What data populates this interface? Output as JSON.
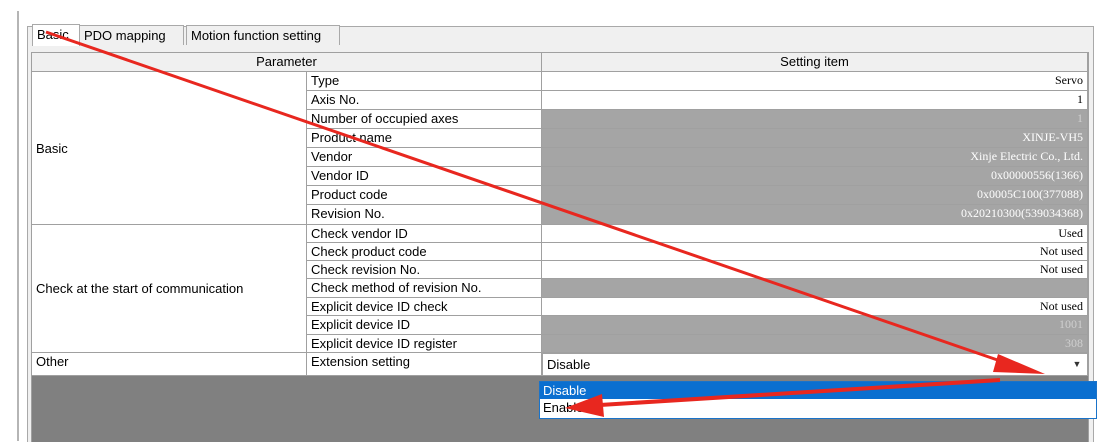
{
  "tabs": [
    {
      "label": "Basic",
      "active": true
    },
    {
      "label": "PDO mapping",
      "active": false
    },
    {
      "label": "Motion function setting",
      "active": false
    }
  ],
  "table": {
    "headers": {
      "parameter": "Parameter",
      "setting": "Setting item"
    },
    "groups": {
      "basic": "Basic",
      "check": "Check at the start of communication",
      "other": "Other"
    },
    "rows": [
      {
        "item": "Type",
        "value": "Servo",
        "editable": true
      },
      {
        "item": "Axis No.",
        "value": "1",
        "editable": true
      },
      {
        "item": "Number of occupied axes",
        "value": "1",
        "editable": false
      },
      {
        "item": "Product name",
        "value": "XINJE-VH5",
        "editable": false
      },
      {
        "item": "Vendor",
        "value": "Xinje Electric Co., Ltd.",
        "editable": false
      },
      {
        "item": "Vendor ID",
        "value": "0x00000556(1366)",
        "editable": false
      },
      {
        "item": "Product code",
        "value": "0x0005C100(377088)",
        "editable": false
      },
      {
        "item": "Revision No.",
        "value": "0x20210300(539034368)",
        "editable": false
      },
      {
        "item": "Check vendor ID",
        "value": "Used",
        "editable": true
      },
      {
        "item": "Check product code",
        "value": "Not used",
        "editable": true
      },
      {
        "item": "Check revision No.",
        "value": "Not used",
        "editable": true
      },
      {
        "item": "Check method of revision No.",
        "value": "",
        "editable": false
      },
      {
        "item": "Explicit device ID check",
        "value": "Not used",
        "editable": true
      },
      {
        "item": "Explicit device ID",
        "value": "1001",
        "editable": false
      },
      {
        "item": "Explicit device ID register",
        "value": "308",
        "editable": false
      }
    ],
    "extension": {
      "item": "Extension setting",
      "value": "Disable"
    }
  },
  "dropdown": {
    "options": [
      "Disable",
      "Enable"
    ],
    "selected": "Disable"
  },
  "colors": {
    "annotation_arrow": "#e8271f",
    "selection": "#0a6fd0",
    "readonly_cell": "#a5a5a5"
  }
}
